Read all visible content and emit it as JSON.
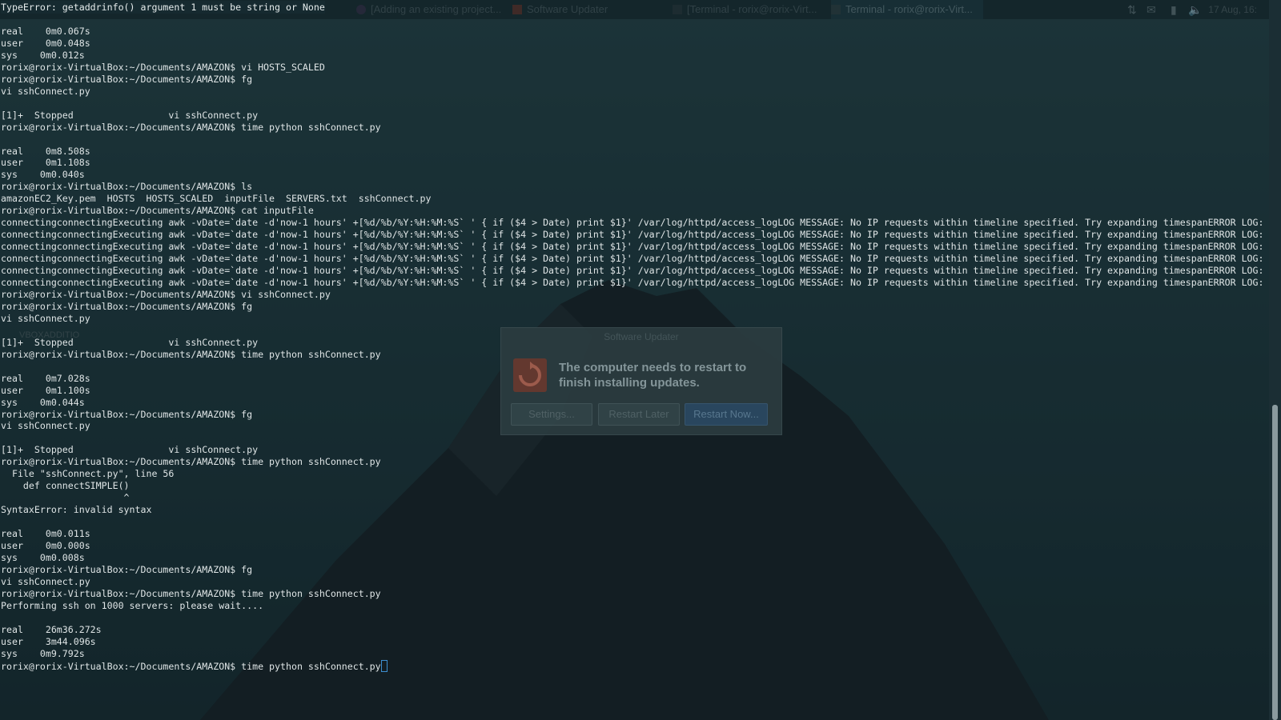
{
  "taskbar": {
    "error_title": "TypeError: getaddrinfo() argument 1 must be string or None",
    "tasks": [
      {
        "label": "[Adding an existing project..."
      },
      {
        "label": "Software Updater"
      },
      {
        "label": "[Terminal - rorix@rorix-Virt..."
      },
      {
        "label": "Terminal - rorix@rorix-Virt..."
      }
    ],
    "clock": "17 Aug, 16:"
  },
  "terminal": {
    "lines": [
      "real\t0m0.067s",
      "user\t0m0.048s",
      "sys\t0m0.012s",
      "rorix@rorix-VirtualBox:~/Documents/AMAZON$ vi HOSTS_SCALED",
      "rorix@rorix-VirtualBox:~/Documents/AMAZON$ fg",
      "vi sshConnect.py",
      "",
      "[1]+  Stopped                 vi sshConnect.py",
      "rorix@rorix-VirtualBox:~/Documents/AMAZON$ time python sshConnect.py",
      "",
      "real\t0m8.508s",
      "user\t0m1.108s",
      "sys\t0m0.040s",
      "rorix@rorix-VirtualBox:~/Documents/AMAZON$ ls",
      "amazonEC2_Key.pem  HOSTS  HOSTS_SCALED  inputFile  SERVERS.txt  sshConnect.py",
      "rorix@rorix-VirtualBox:~/Documents/AMAZON$ cat inputFile",
      "connectingconnectingExecuting awk -vDate=`date -d'now-1 hours' +[%d/%b/%Y:%H:%M:%S` ' { if ($4 > Date) print $1}' /var/log/httpd/access_logLOG MESSAGE: No IP requests within timeline specified. Try expanding timespanERROR LOG:",
      "connectingconnectingExecuting awk -vDate=`date -d'now-1 hours' +[%d/%b/%Y:%H:%M:%S` ' { if ($4 > Date) print $1}' /var/log/httpd/access_logLOG MESSAGE: No IP requests within timeline specified. Try expanding timespanERROR LOG:",
      "connectingconnectingExecuting awk -vDate=`date -d'now-1 hours' +[%d/%b/%Y:%H:%M:%S` ' { if ($4 > Date) print $1}' /var/log/httpd/access_logLOG MESSAGE: No IP requests within timeline specified. Try expanding timespanERROR LOG:",
      "connectingconnectingExecuting awk -vDate=`date -d'now-1 hours' +[%d/%b/%Y:%H:%M:%S` ' { if ($4 > Date) print $1}' /var/log/httpd/access_logLOG MESSAGE: No IP requests within timeline specified. Try expanding timespanERROR LOG:",
      "connectingconnectingExecuting awk -vDate=`date -d'now-1 hours' +[%d/%b/%Y:%H:%M:%S` ' { if ($4 > Date) print $1}' /var/log/httpd/access_logLOG MESSAGE: No IP requests within timeline specified. Try expanding timespanERROR LOG:",
      "connectingconnectingExecuting awk -vDate=`date -d'now-1 hours' +[%d/%b/%Y:%H:%M:%S` ' { if ($4 > Date) print $1}' /var/log/httpd/access_logLOG MESSAGE: No IP requests within timeline specified. Try expanding timespanERROR LOG:",
      "rorix@rorix-VirtualBox:~/Documents/AMAZON$ vi sshConnect.py",
      "rorix@rorix-VirtualBox:~/Documents/AMAZON$ fg",
      "vi sshConnect.py",
      "",
      "[1]+  Stopped                 vi sshConnect.py",
      "rorix@rorix-VirtualBox:~/Documents/AMAZON$ time python sshConnect.py",
      "",
      "real\t0m7.028s",
      "user\t0m1.100s",
      "sys\t0m0.044s",
      "rorix@rorix-VirtualBox:~/Documents/AMAZON$ fg",
      "vi sshConnect.py",
      "",
      "[1]+  Stopped                 vi sshConnect.py",
      "rorix@rorix-VirtualBox:~/Documents/AMAZON$ time python sshConnect.py",
      "  File \"sshConnect.py\", line 56",
      "    def connectSIMPLE()",
      "                      ^",
      "SyntaxError: invalid syntax",
      "",
      "real\t0m0.011s",
      "user\t0m0.000s",
      "sys\t0m0.008s",
      "rorix@rorix-VirtualBox:~/Documents/AMAZON$ fg",
      "vi sshConnect.py",
      "rorix@rorix-VirtualBox:~/Documents/AMAZON$ time python sshConnect.py",
      "Performing ssh on 1000 servers: please wait....",
      "",
      "real\t26m36.272s",
      "user\t3m44.096s",
      "sys\t0m9.792s"
    ],
    "prompt_line": "rorix@rorix-VirtualBox:~/Documents/AMAZON$ time python sshConnect.py"
  },
  "desktop": {
    "label_vbox": "VBOXADDITIO"
  },
  "dialog": {
    "title": "Software Updater",
    "message": "The computer needs to restart to finish installing updates.",
    "settings_label": "Settings...",
    "later_label": "Restart Later",
    "now_label": "Restart Now..."
  },
  "colors": {
    "terminal_text": "#dfe5e6",
    "cursor": "#3d8fd0",
    "wallpaper_sky": "#1f3a40",
    "mountain": "#1a2226"
  }
}
